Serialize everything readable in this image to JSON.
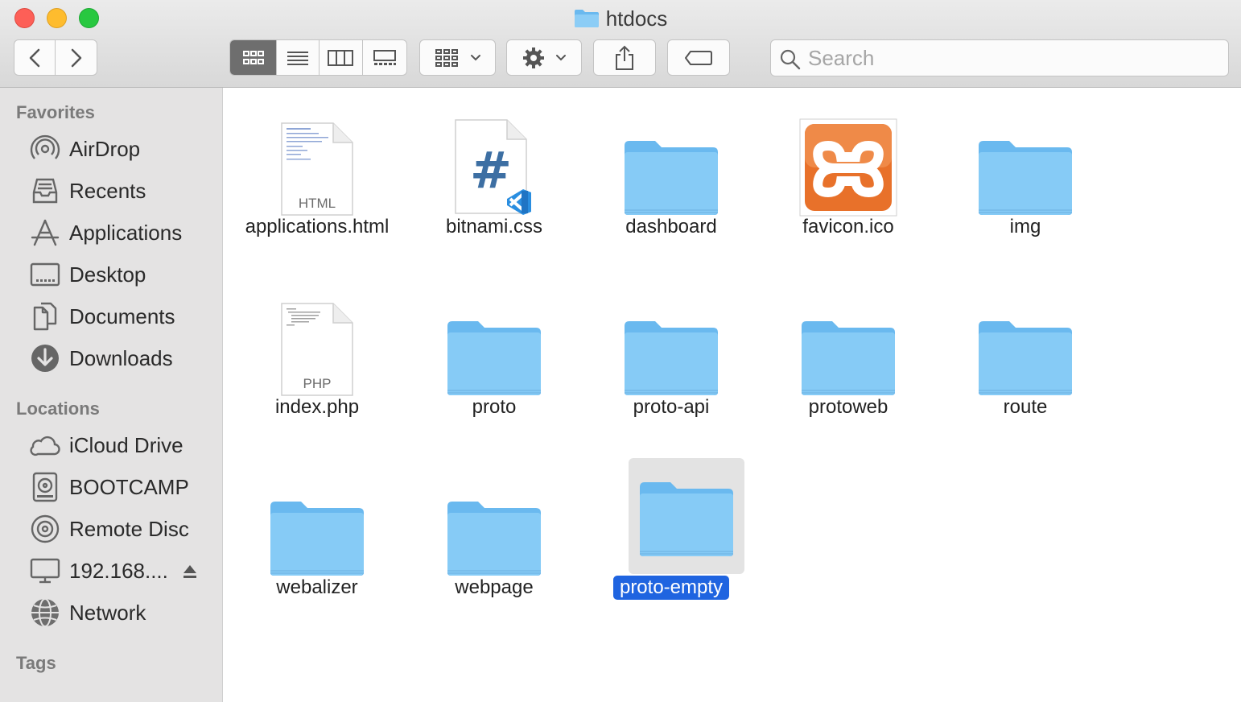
{
  "window": {
    "title": "htdocs"
  },
  "toolbar": {
    "back": "back",
    "forward": "forward",
    "view_modes": [
      "icon-view",
      "list-view",
      "column-view",
      "gallery-view"
    ],
    "group_by": "group-by",
    "action": "action",
    "share": "share",
    "tags": "edit-tags"
  },
  "search": {
    "placeholder": "Search",
    "value": ""
  },
  "sidebar": {
    "favorites_title": "Favorites",
    "favorites": [
      {
        "label": "AirDrop",
        "icon": "airdrop-icon"
      },
      {
        "label": "Recents",
        "icon": "recents-icon"
      },
      {
        "label": "Applications",
        "icon": "applications-icon"
      },
      {
        "label": "Desktop",
        "icon": "desktop-icon"
      },
      {
        "label": "Documents",
        "icon": "documents-icon"
      },
      {
        "label": "Downloads",
        "icon": "downloads-icon"
      }
    ],
    "locations_title": "Locations",
    "locations": [
      {
        "label": "iCloud Drive",
        "icon": "icloud-icon"
      },
      {
        "label": "BOOTCAMP",
        "icon": "disk-icon"
      },
      {
        "label": "Remote Disc",
        "icon": "disc-icon"
      },
      {
        "label": "192.168....",
        "icon": "monitor-icon"
      },
      {
        "label": "Network",
        "icon": "network-icon"
      }
    ],
    "tags_title": "Tags"
  },
  "files": [
    {
      "name": "applications.html",
      "kind": "html",
      "ext": "HTML"
    },
    {
      "name": "bitnami.css",
      "kind": "css"
    },
    {
      "name": "dashboard",
      "kind": "folder"
    },
    {
      "name": "favicon.ico",
      "kind": "ico"
    },
    {
      "name": "img",
      "kind": "folder"
    },
    {
      "name": "index.php",
      "kind": "php",
      "ext": "PHP"
    },
    {
      "name": "proto",
      "kind": "folder"
    },
    {
      "name": "proto-api",
      "kind": "folder"
    },
    {
      "name": "protoweb",
      "kind": "folder"
    },
    {
      "name": "route",
      "kind": "folder"
    },
    {
      "name": "webalizer",
      "kind": "folder"
    },
    {
      "name": "webpage",
      "kind": "folder"
    },
    {
      "name": "proto-empty",
      "kind": "folder",
      "selected": true
    }
  ],
  "colors": {
    "selection": "#1f64e0",
    "folder": "#7cc4f4",
    "xampp": "#e8712a"
  }
}
